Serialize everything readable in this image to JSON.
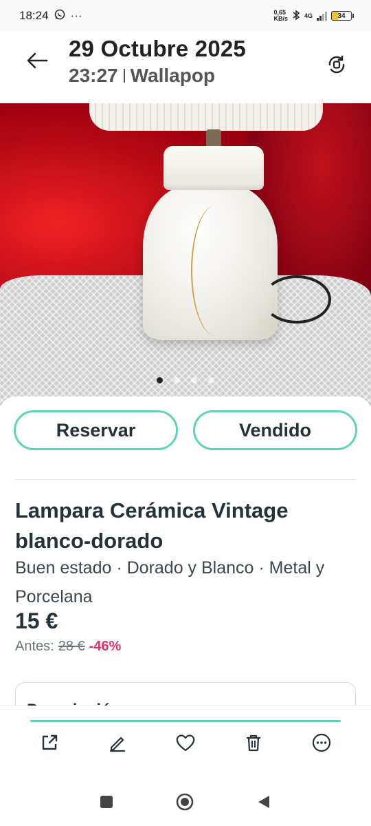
{
  "status_bar": {
    "time": "18:24",
    "more_indicator": "···",
    "net_speed": "0,65\nKB/s",
    "network_type": "4G",
    "battery_level": "34"
  },
  "header": {
    "date": "29 Octubre 2025",
    "time": "23:27",
    "app_name": "Wallapop",
    "icons": {
      "back": "arrow-left-icon",
      "rotate": "rotate-screen-icon"
    }
  },
  "gallery": {
    "page_count": 4,
    "current_page": 1
  },
  "actions": {
    "reserve_label": "Reservar",
    "sold_label": "Vendido"
  },
  "product": {
    "title": "Lampara Cerámica Vintage blanco-dorado",
    "attributes": "Buen estado · Dorado y Blanco · Metal y Porcelana",
    "price": "15 €",
    "before_label": "Antes:",
    "old_price": "28 €",
    "discount": "-46%"
  },
  "description": {
    "label": "Descripción"
  },
  "toolbar": {
    "items": [
      "share-icon",
      "edit-icon",
      "favorite-icon",
      "delete-icon",
      "more-icon"
    ]
  },
  "colors": {
    "accent": "#5fd3b8",
    "discount": "#e0336b",
    "text": "#253238"
  }
}
